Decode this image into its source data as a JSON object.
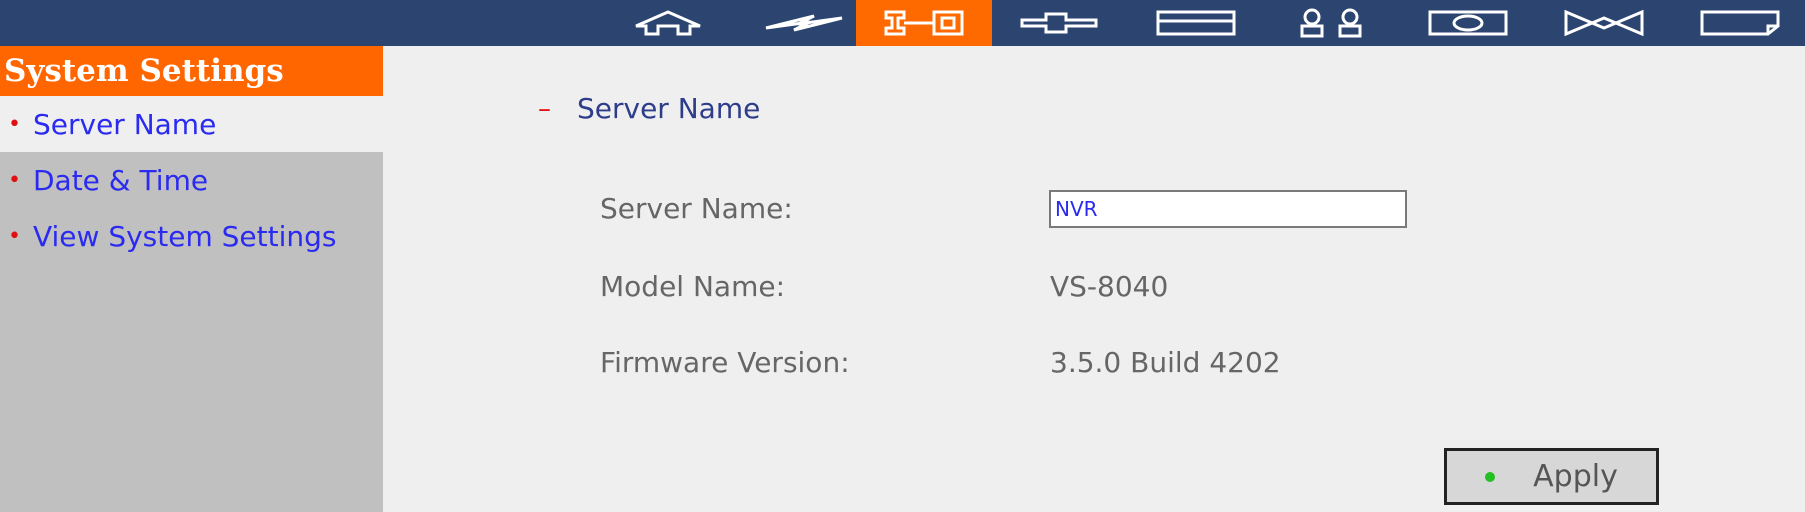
{
  "nav": {
    "icons": [
      "home-icon",
      "lightning-icon",
      "wrench-icon",
      "network-icon",
      "disk-icon",
      "users-icon",
      "camera-icon",
      "bowtie-icon",
      "note-icon"
    ],
    "active_index": 2,
    "active_color": "#ff6a00",
    "bar_color": "#2b4570"
  },
  "sidebar": {
    "header": "System Settings",
    "items": [
      {
        "label": "Server Name"
      },
      {
        "label": "Date & Time"
      },
      {
        "label": "View System Settings"
      }
    ],
    "bullet": "•"
  },
  "main": {
    "section_dash": "–",
    "section_title": "Server Name",
    "server_name_label": "Server Name:",
    "server_name_value": "NVR",
    "model_name_label": "Model Name:",
    "model_name_value": "VS-8040",
    "firmware_label": "Firmware Version:",
    "firmware_value": "3.5.0 Build 4202",
    "apply_label": "Apply"
  }
}
